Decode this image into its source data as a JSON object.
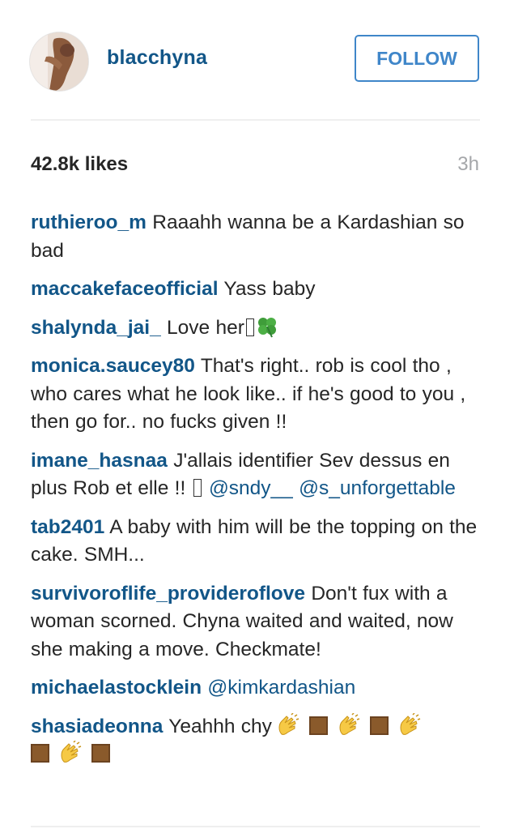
{
  "header": {
    "username": "blacchyna",
    "follow_label": "FOLLOW"
  },
  "stats": {
    "likes": "42.8k likes",
    "time_ago": "3h"
  },
  "colors": {
    "link": "#125688",
    "follow_accent": "#3f86c9",
    "muted": "#a5a7aa",
    "text": "#262626"
  },
  "comments": [
    {
      "author": "ruthieroo_m",
      "text": "Raaahh wanna be a Kardashian so bad"
    },
    {
      "author": "maccakefaceofficial",
      "text": "Yass baby"
    },
    {
      "author": "shalynda_jai_",
      "text": "Love her",
      "icons": [
        "missing-glyph",
        "four-leaf-clover-icon"
      ]
    },
    {
      "author": "monica.saucey80",
      "text": "That's right.. rob is cool tho , who cares what he look like.. if he's good to you , then go for.. no fucks given !!"
    },
    {
      "author": "imane_hasnaa",
      "text": "J'allais identifier Sev dessus en plus Rob et elle !!",
      "icons": [
        "missing-glyph"
      ],
      "mentions": [
        "@sndy__",
        "@s_unforgettable"
      ]
    },
    {
      "author": "tab2401",
      "text": "A baby with him will be the topping on the cake. SMH..."
    },
    {
      "author": "survivoroflife_provideroflove",
      "text": "Don't fux with a woman scorned. Chyna waited and waited, now she making a move. Checkmate!"
    },
    {
      "author": "michaelastocklein",
      "text": "",
      "mentions": [
        "@kimkardashian"
      ]
    },
    {
      "author": "shasiadeonna",
      "text": "Yeahhh chy",
      "icons": [
        "clapping-hands-icon",
        "skin-tone-square",
        "clapping-hands-icon",
        "skin-tone-square",
        "clapping-hands-icon",
        "skin-tone-square",
        "clapping-hands-icon",
        "skin-tone-square"
      ]
    }
  ]
}
